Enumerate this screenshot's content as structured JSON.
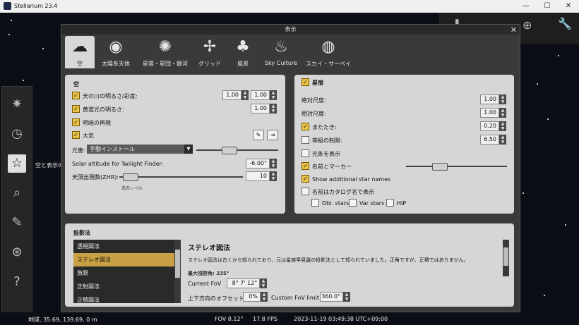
{
  "window": {
    "title": "Stellarium 23.4",
    "min": "—",
    "max": "☐",
    "close": "✕"
  },
  "sky_hint": "空と表示の",
  "status": {
    "location": "地球, 35.69, 139.69, 0 m",
    "fov": "FOV 8.12°",
    "fps": "17.8 FPS",
    "datetime": "2023-11-19 03:49:38 UTC+09:00"
  },
  "dialog": {
    "title": "表示",
    "close": "✕",
    "tabs": [
      {
        "label": "空",
        "icon": "sky-icon"
      },
      {
        "label": "太陽系天体",
        "icon": "planet-icon"
      },
      {
        "label": "星雲・星団・銀河",
        "icon": "galaxy-icon"
      },
      {
        "label": "グリッド",
        "icon": "grid-icon"
      },
      {
        "label": "風景",
        "icon": "landscape-icon"
      },
      {
        "label": "Sky Culture",
        "icon": "fire-icon"
      },
      {
        "label": "スカイ・サーベイ",
        "icon": "sphere-icon"
      }
    ],
    "sky": {
      "title": "空",
      "milky_way": {
        "label": "天の川の明るさ/彩度:",
        "v1": "1.00",
        "v2": "1.00",
        "checked": true
      },
      "zodiacal": {
        "label": "黄道光の明るさ:",
        "v": "1.00",
        "checked": true
      },
      "twilight": {
        "label": "明暗の再現",
        "checked": true
      },
      "atmosphere": {
        "label": "大気",
        "checked": true
      },
      "light_pollution_label": "光害:",
      "light_pollution_value": "手動インストール",
      "solar_alt_label": "Solar altitude for Twilight Finder:",
      "solar_alt_value": "-6.00°",
      "zhr_label": "天頂出現数(ZHR):",
      "zhr_value": "10",
      "zhr_note": "過去レベル",
      "light_pollution_level": 0.38,
      "zhr_level": 0.03
    },
    "stars": {
      "title": "星宿",
      "title_checked": true,
      "abs_scale_label": "絶対尺度:",
      "abs_scale": "1.00",
      "rel_scale_label": "相対尺度:",
      "rel_scale": "1.00",
      "twinkle_label": "またたき:",
      "twinkle": "0.20",
      "twinkle_checked": true,
      "mag_limit_label": "等級の制限:",
      "mag_limit": "6.50",
      "mag_limit_checked": false,
      "spikes_label": "光条を表示",
      "spikes_checked": false,
      "names_label": "名前とマーカー",
      "names_checked": true,
      "add_names_label": "Show additional star names",
      "add_names_checked": true,
      "catalog_label": "名前はカタログ名で表示",
      "catalog_checked": false,
      "dbl_label": "Dbl. stars",
      "var_label": "Var stars",
      "hip_label": "HIP",
      "names_level": 0.3
    },
    "projection": {
      "title": "投影法",
      "items": [
        "透視図法",
        "ステレオ図法",
        "魚眼",
        "正射図法",
        "正積図法"
      ],
      "selected_index": 1,
      "heading": "ステレオ図法",
      "desc": "ステレオ図法は古くから知られており、元は星座早見盤の投影法として知られていました。正角ですが、正積ではありません。",
      "maxfov": "最大視野角: 235°",
      "current_fov_label": "Current FoV",
      "current_fov": "8° 7' 12\"",
      "offset_label": "上下方向のオフセット",
      "offset": "0%",
      "custom_fov_label": "Custom FoV limit",
      "custom_fov": "360.0°"
    }
  }
}
